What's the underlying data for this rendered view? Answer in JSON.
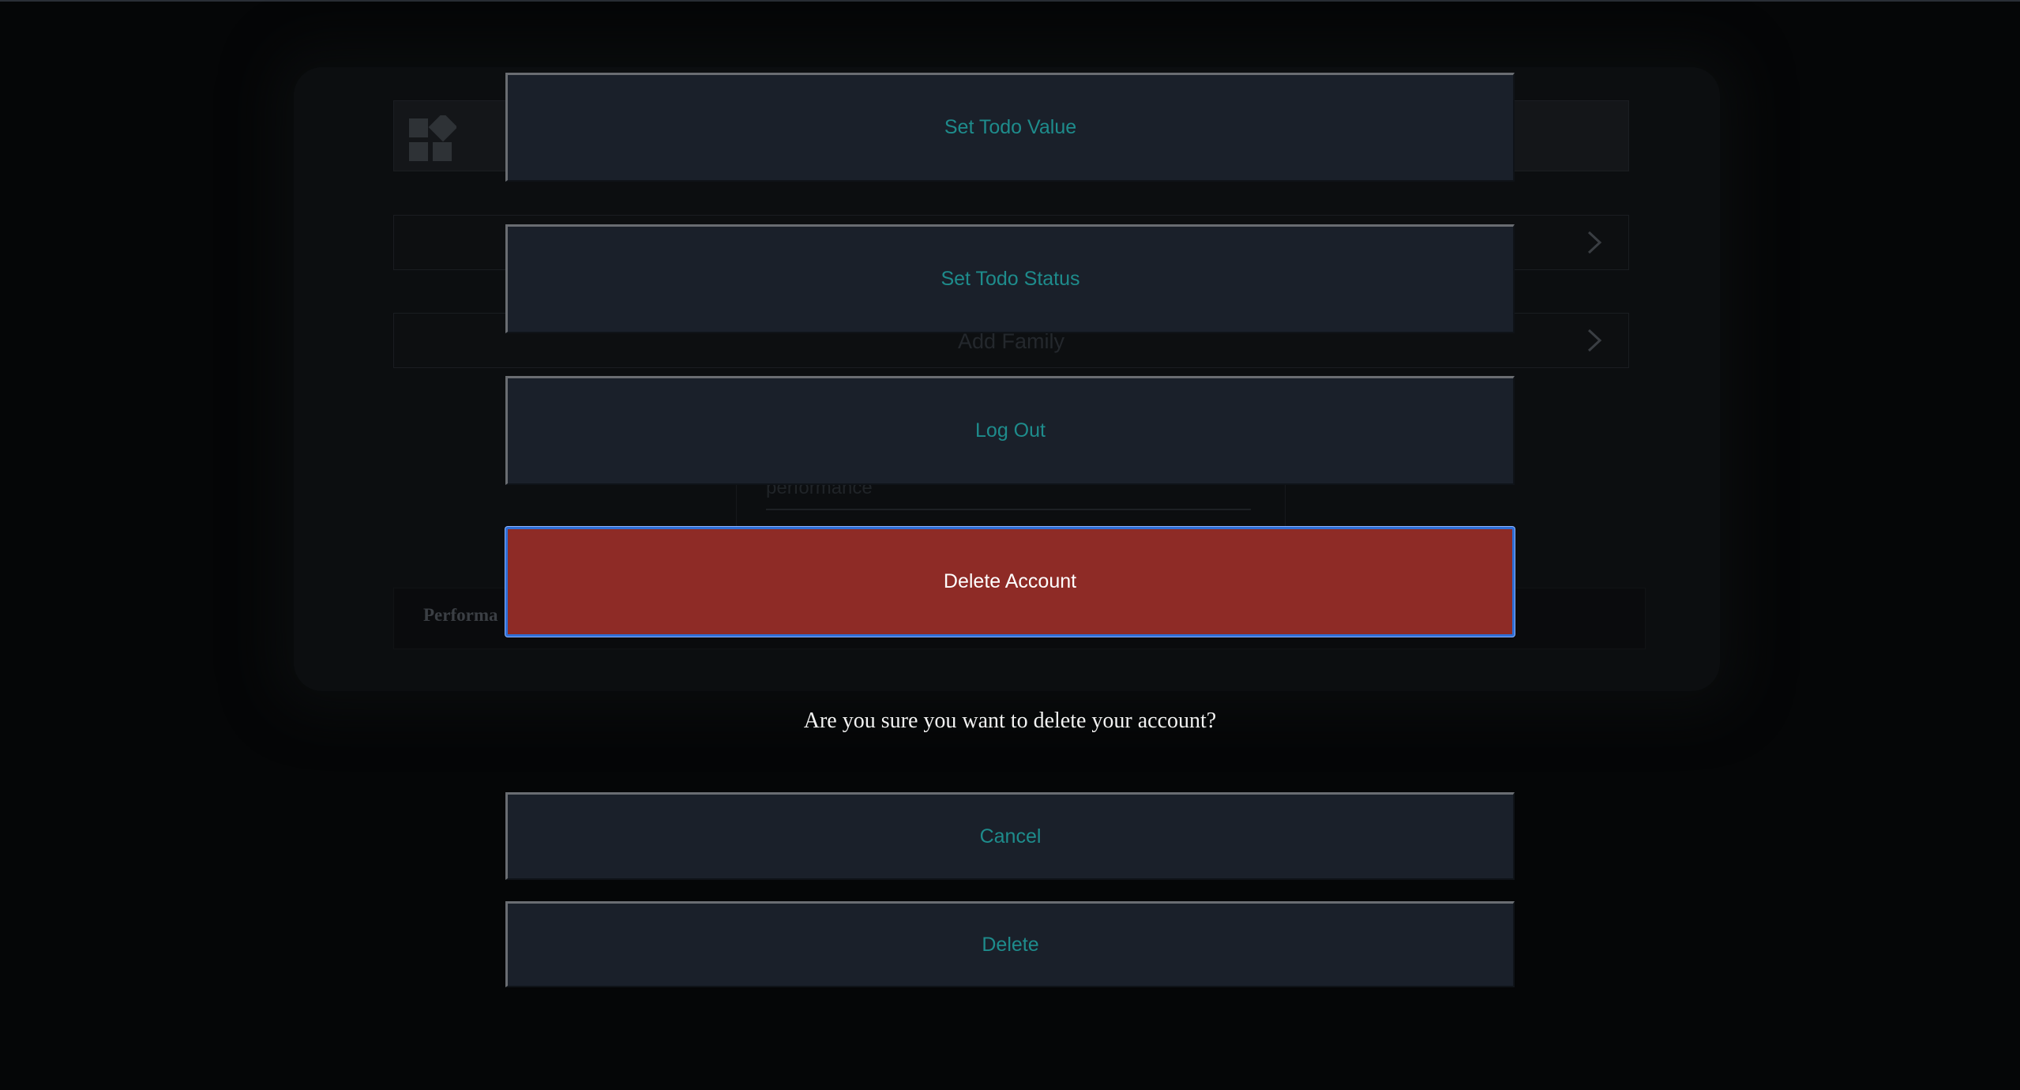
{
  "background": {
    "rows": [
      {
        "label": ""
      },
      {
        "label": "Add Family"
      }
    ],
    "form": {
      "input_value": "performance"
    },
    "footer": {
      "label": "Performa"
    }
  },
  "modal": {
    "actions": {
      "set_todo_value": "Set Todo Value",
      "set_todo_status": "Set Todo Status",
      "log_out": "Log Out",
      "delete_account": "Delete Account"
    },
    "confirm": {
      "message": "Are you sure you want to delete your account?",
      "cancel_label": "Cancel",
      "delete_label": "Delete"
    }
  },
  "colors": {
    "button_bg": "#1a202a",
    "button_text": "#1e8c8c",
    "danger_bg": "#8e2b26",
    "focus_ring": "#2f6fd6",
    "page_bg": "#050607"
  },
  "icons": {
    "toolbar": "grid-shapes-icon",
    "row_chevron": "chevron-right-icon"
  }
}
